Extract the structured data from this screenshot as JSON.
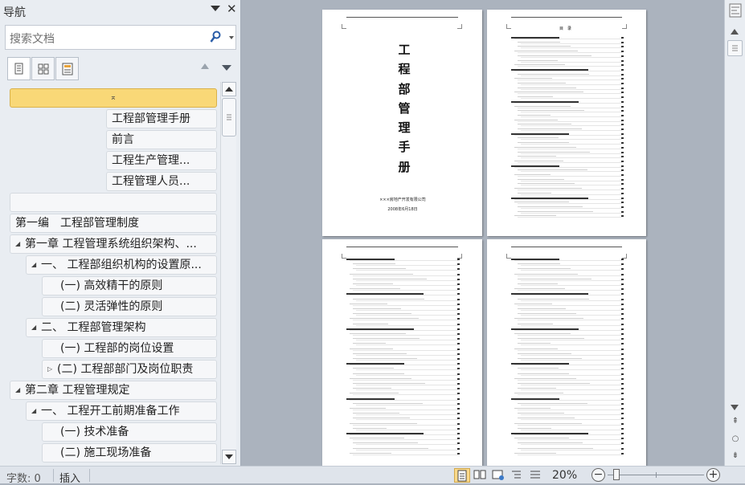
{
  "nav": {
    "title": "导航",
    "search_placeholder": "搜索文档",
    "tree": [
      {
        "label": "",
        "level": 0,
        "caret": "⌅",
        "selected": true
      },
      {
        "label": "工程部管理手册",
        "level": 1,
        "caret": ""
      },
      {
        "label": "前言",
        "level": 1,
        "caret": ""
      },
      {
        "label": "工程生产管理...",
        "level": 1,
        "caret": ""
      },
      {
        "label": "工程管理人员...",
        "level": 1,
        "caret": ""
      },
      {
        "label": "",
        "level": 0,
        "caret": ""
      },
      {
        "label": "第一编　工程部管理制度",
        "level": 0,
        "caret": ""
      },
      {
        "label": "第一章 工程管理系统组织架构、...",
        "level": 0,
        "caret": "◢"
      },
      {
        "label": "一、 工程部组织机构的设置原...",
        "level": 1,
        "caret": "◢"
      },
      {
        "label": "(一) 高效精干的原则",
        "level": 2,
        "caret": ""
      },
      {
        "label": "(二) 灵活弹性的原则",
        "level": 2,
        "caret": ""
      },
      {
        "label": "二、 工程部管理架构",
        "level": 1,
        "caret": "◢"
      },
      {
        "label": "(一) 工程部的岗位设置",
        "level": 2,
        "caret": ""
      },
      {
        "label": "(二) 工程部部门及岗位职责",
        "level": 2,
        "caret": "▷"
      },
      {
        "label": "第二章 工程管理规定",
        "level": 0,
        "caret": "◢"
      },
      {
        "label": "一、 工程开工前期准备工作",
        "level": 1,
        "caret": "◢"
      },
      {
        "label": "(一) 技术准备",
        "level": 2,
        "caret": ""
      },
      {
        "label": "(二) 施工现场准备",
        "level": 2,
        "caret": ""
      }
    ]
  },
  "document": {
    "cover_title_chars": [
      "工",
      "程",
      "部",
      "管",
      "理",
      "手",
      "册"
    ],
    "company": "×××房地产开发有限公司",
    "date": "2008年6月18日",
    "toc_heading": "目　录"
  },
  "status": {
    "word_count": "字数: 0",
    "insert_mode": "插入",
    "zoom": "20%",
    "zoom_level_percent": 20
  },
  "colors": {
    "selected_node": "#f9d877",
    "view_button_active": "#fbd98b",
    "workspace": "#abb3be"
  }
}
